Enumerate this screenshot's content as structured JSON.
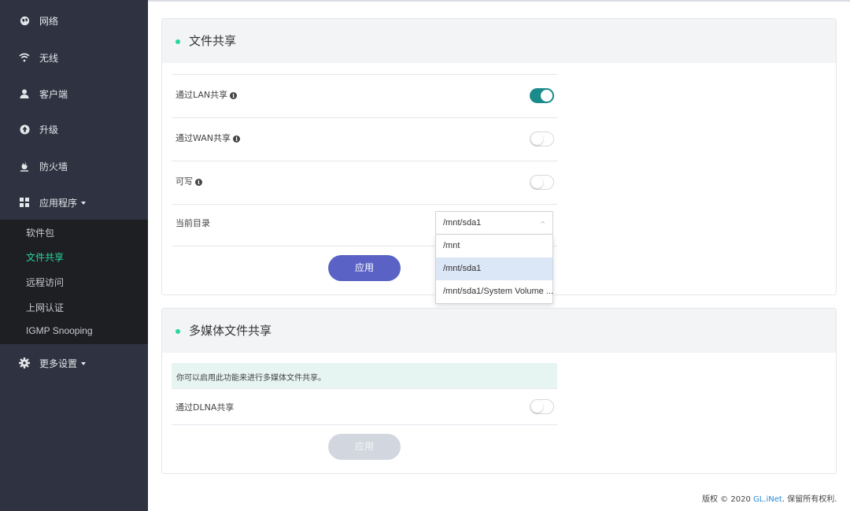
{
  "sidebar": {
    "items": [
      {
        "icon": "globe-icon",
        "label": "网络"
      },
      {
        "icon": "wifi-icon",
        "label": "无线"
      },
      {
        "icon": "user-icon",
        "label": "客户端"
      },
      {
        "icon": "upgrade-icon",
        "label": "升级"
      },
      {
        "icon": "firewall-icon",
        "label": "防火墙"
      },
      {
        "icon": "apps-icon",
        "label": "应用程序"
      },
      {
        "icon": "gear-icon",
        "label": "更多设置"
      }
    ],
    "submenu": [
      "软件包",
      "文件共享",
      "远程访问",
      "上网认证",
      "IGMP Snooping"
    ],
    "active_sub": "文件共享",
    "accent_color": "#27d89b"
  },
  "file_share": {
    "title": "文件共享",
    "rows": [
      {
        "label": "通过LAN共享",
        "info": "i",
        "toggle": "on"
      },
      {
        "label": "通过WAN共享",
        "info": "i",
        "toggle": "off"
      },
      {
        "label": "可写",
        "info": "i",
        "toggle": "off"
      }
    ],
    "dir_label": "当前目录",
    "dir_value": "/mnt/sda1",
    "dir_options": [
      "/mnt",
      "/mnt/sda1",
      "/mnt/sda1/System Volume ..."
    ],
    "apply_label": "应用"
  },
  "media_share": {
    "title": "多媒体文件共享",
    "notice": "你可以启用此功能来进行多媒体文件共享。",
    "dlna_label": "通过DLNA共享",
    "dlna_toggle": "off",
    "apply_label": "应用"
  },
  "footer": {
    "prefix": "版权 © 2020 ",
    "link": "GL.iNet",
    "suffix": ". 保留所有权利."
  }
}
